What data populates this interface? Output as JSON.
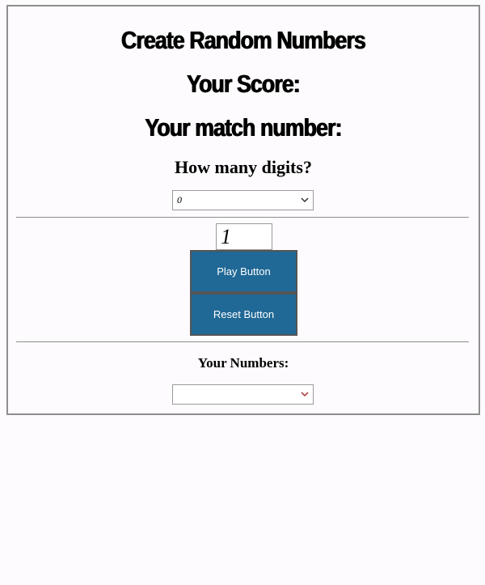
{
  "headings": {
    "title": "Create Random Numbers",
    "score_label": "Your Score:",
    "match_label": "Your match number:",
    "digits_prompt": "How many digits?",
    "numbers_label": "Your Numbers:"
  },
  "digits_select": {
    "selected": "0",
    "chevron_icon": "chevron-down-icon",
    "chevron_color": "#333333"
  },
  "number_input": {
    "value": "1"
  },
  "buttons": {
    "play_label": "Play Button",
    "reset_label": "Reset Button",
    "color": "#206896"
  },
  "numbers_select": {
    "selected": "",
    "chevron_icon": "chevron-down-icon",
    "chevron_color": "#b03030"
  }
}
